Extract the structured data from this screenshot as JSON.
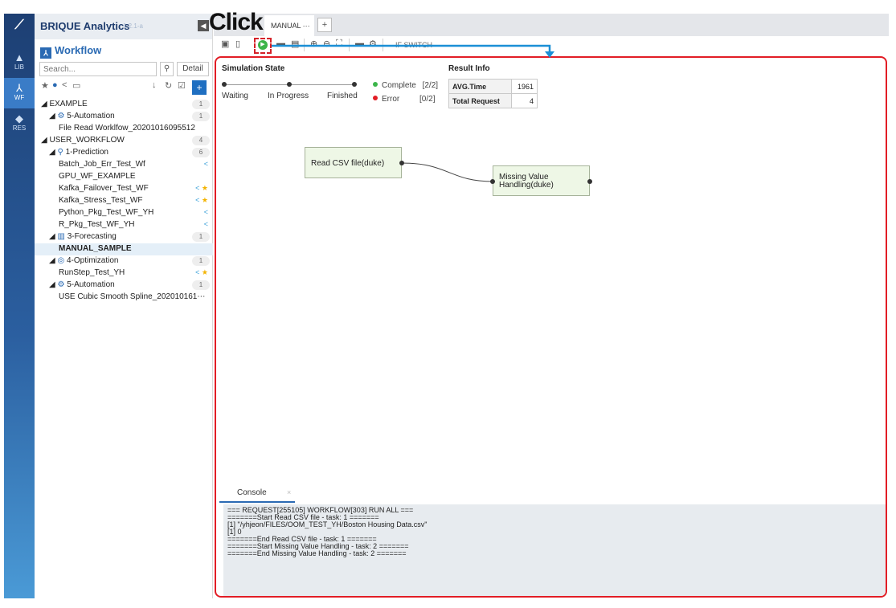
{
  "app": {
    "name": "BRIQUE Analytics",
    "version": "1.2.1-a"
  },
  "rail": {
    "items": [
      {
        "label": "LIB",
        "icon": "library-icon"
      },
      {
        "label": "WF",
        "icon": "workflow-icon"
      },
      {
        "label": "RES",
        "icon": "layers-icon"
      }
    ]
  },
  "sidebar": {
    "title": "Workflow",
    "search": {
      "placeholder": "Search...",
      "detail_label": "Detail"
    },
    "tree": [
      {
        "kind": "root",
        "label": "EXAMPLE",
        "count": "1"
      },
      {
        "kind": "group",
        "label": "5-Automation",
        "icon": "automation-icon",
        "count": "1"
      },
      {
        "kind": "item",
        "label": "File Read Worklfow_20201016095512"
      },
      {
        "kind": "root",
        "label": "USER_WORKFLOW",
        "count": "4"
      },
      {
        "kind": "group",
        "label": "1-Prediction",
        "icon": "prediction-icon",
        "count": "6"
      },
      {
        "kind": "item",
        "label": "Batch_Job_Err_Test_Wf",
        "share": true
      },
      {
        "kind": "item",
        "label": "GPU_WF_EXAMPLE"
      },
      {
        "kind": "item",
        "label": "Kafka_Failover_Test_WF",
        "share": true,
        "star": true
      },
      {
        "kind": "item",
        "label": "Kafka_Stress_Test_WF",
        "share": true,
        "star": true
      },
      {
        "kind": "item",
        "label": "Python_Pkg_Test_WF_YH",
        "share": true
      },
      {
        "kind": "item",
        "label": "R_Pkg_Test_WF_YH",
        "share": true
      },
      {
        "kind": "group",
        "label": "3-Forecasting",
        "icon": "forecasting-icon",
        "count": "1"
      },
      {
        "kind": "item",
        "label": "MANUAL_SAMPLE",
        "selected": true
      },
      {
        "kind": "group",
        "label": "4-Optimization",
        "icon": "optimization-icon",
        "count": "1"
      },
      {
        "kind": "item",
        "label": "RunStep_Test_YH",
        "share": true,
        "star": true
      },
      {
        "kind": "group",
        "label": "5-Automation",
        "icon": "automation-icon",
        "count": "1"
      },
      {
        "kind": "item",
        "label": "USE Cubic Smooth Spline_202010161⋯"
      }
    ]
  },
  "tabs": {
    "active_label": "MANUAL ···",
    "add_label": "+"
  },
  "toolbar": {
    "if_switch_label": "IF  SWITCH"
  },
  "simulation": {
    "title": "Simulation State",
    "stages": [
      "Waiting",
      "In Progress",
      "Finished"
    ],
    "complete_label": "Complete",
    "complete_value": "[2/2]",
    "error_label": "Error",
    "error_value": "[0/2]",
    "complete_color": "#3cb54a",
    "error_color": "#e21d25"
  },
  "result": {
    "title": "Result Info",
    "rows": [
      {
        "key": "AVG.Time",
        "value": "1961"
      },
      {
        "key": "Total Request",
        "value": "4"
      }
    ]
  },
  "nodes": {
    "read_csv": "Read CSV file(duke)",
    "missing_value": "Missing Value\nHandling(duke)"
  },
  "console": {
    "tab_label": "Console",
    "close_label": "×",
    "lines": [
      "=== REQUEST[255105] WORKFLOW[303] RUN ALL ===",
      "",
      "=======Start Read CSV file - task: 1 =======",
      "[1] \"/yhjeon/FILES/OOM_TEST_YH/Boston Housing Data.csv\"",
      "[1] 0",
      "=======End Read CSV file - task: 1 =======",
      "=======Start Missing Value Handling - task: 2 =======",
      "=======End Missing Value Handling - task: 2 ======="
    ]
  },
  "annotation": {
    "label": "Click",
    "arrow_color": "#1b8fd6",
    "box_color": "#d42128"
  }
}
